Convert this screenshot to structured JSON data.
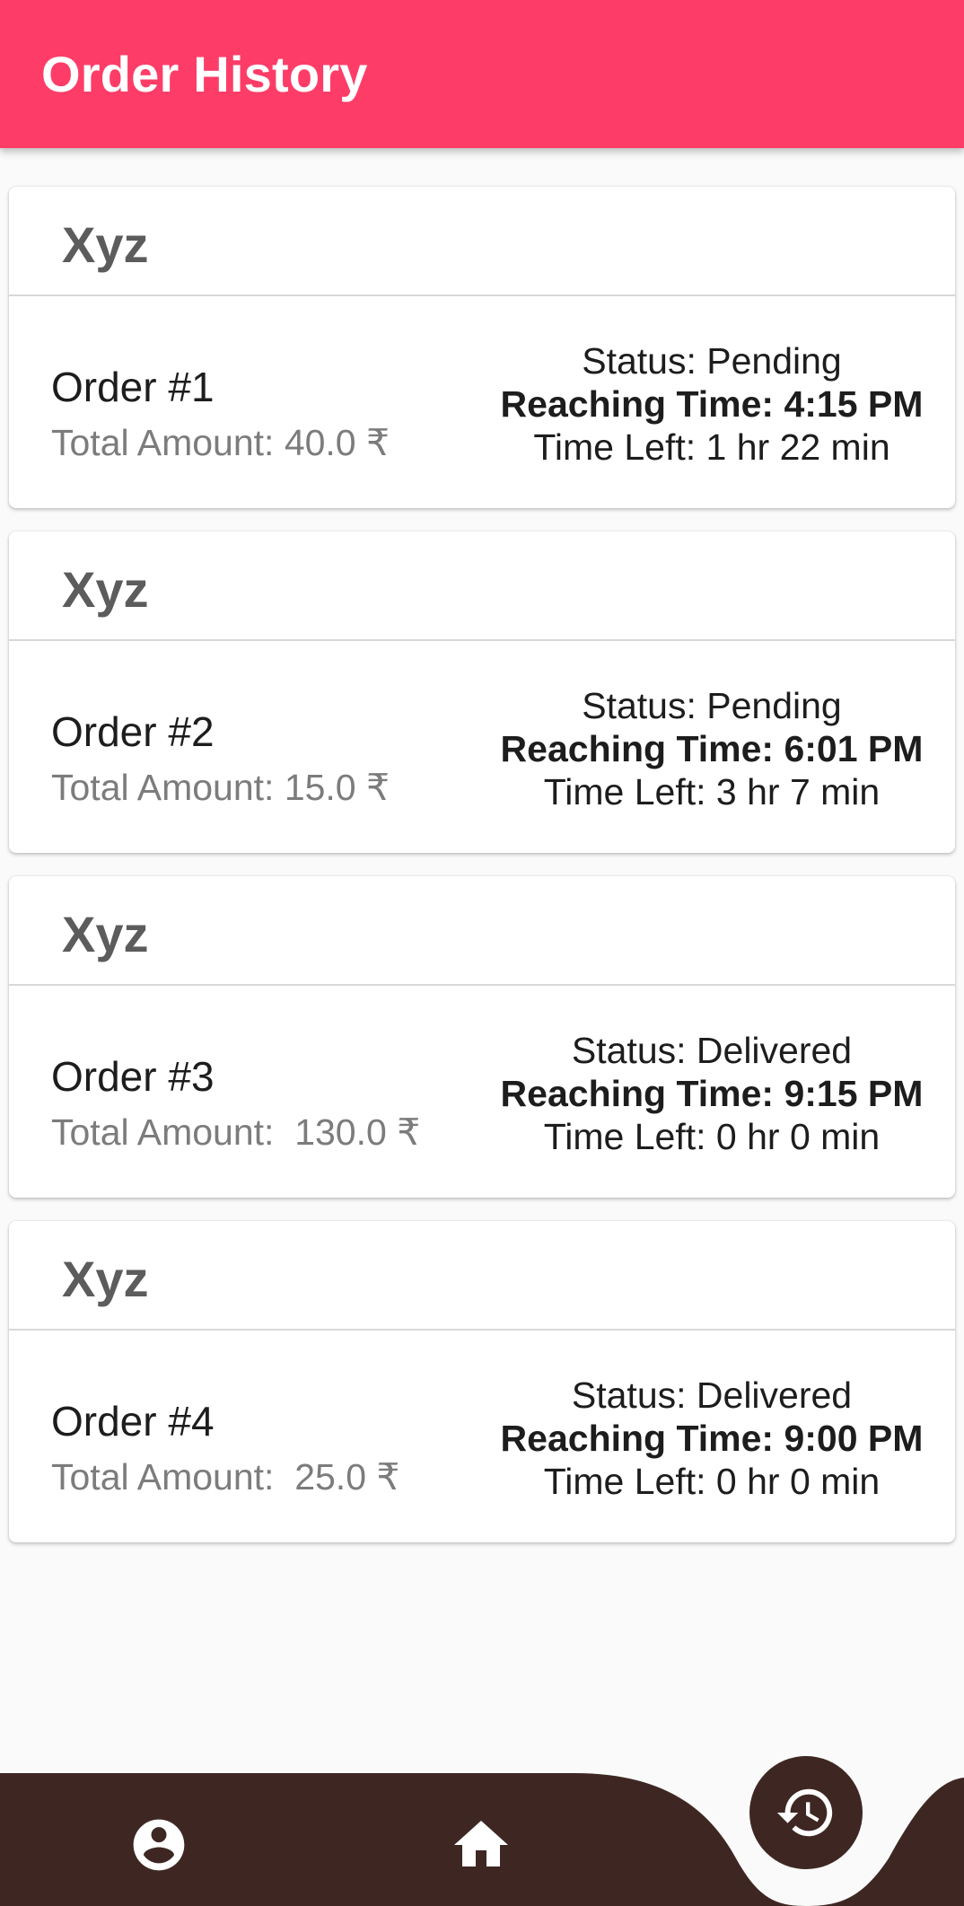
{
  "app_bar": {
    "title": "Order History"
  },
  "orders": [
    {
      "shop": "Xyz",
      "order_label": "Order #1",
      "amount_label": "Total Amount: 40.0 ₹",
      "status_label": "Status: Pending",
      "reaching_label": "Reaching Time: 4:15 PM",
      "time_left_label": "Time Left: 1 hr 22 min"
    },
    {
      "shop": "Xyz",
      "order_label": "Order #2",
      "amount_label": "Total Amount: 15.0 ₹",
      "status_label": "Status: Pending",
      "reaching_label": "Reaching Time: 6:01 PM",
      "time_left_label": "Time Left: 3 hr 7 min"
    },
    {
      "shop": "Xyz",
      "order_label": "Order #3",
      "amount_label": "Total Amount:  130.0 ₹",
      "status_label": "Status: Delivered",
      "reaching_label": "Reaching Time: 9:15 PM",
      "time_left_label": "Time Left: 0 hr 0 min"
    },
    {
      "shop": "Xyz",
      "order_label": "Order #4",
      "amount_label": "Total Amount:  25.0 ₹",
      "status_label": "Status: Delivered",
      "reaching_label": "Reaching Time: 9:00 PM",
      "time_left_label": "Time Left: 0 hr 0 min"
    }
  ],
  "bottom_nav": {
    "items": [
      {
        "icon": "account-circle-icon"
      },
      {
        "icon": "home-icon"
      },
      {
        "icon": "history-icon",
        "selected": true
      }
    ]
  },
  "colors": {
    "app_bar": "#fd3d68",
    "bottom_nav": "#3e2723",
    "background": "#fafafa",
    "card": "#ffffff"
  }
}
